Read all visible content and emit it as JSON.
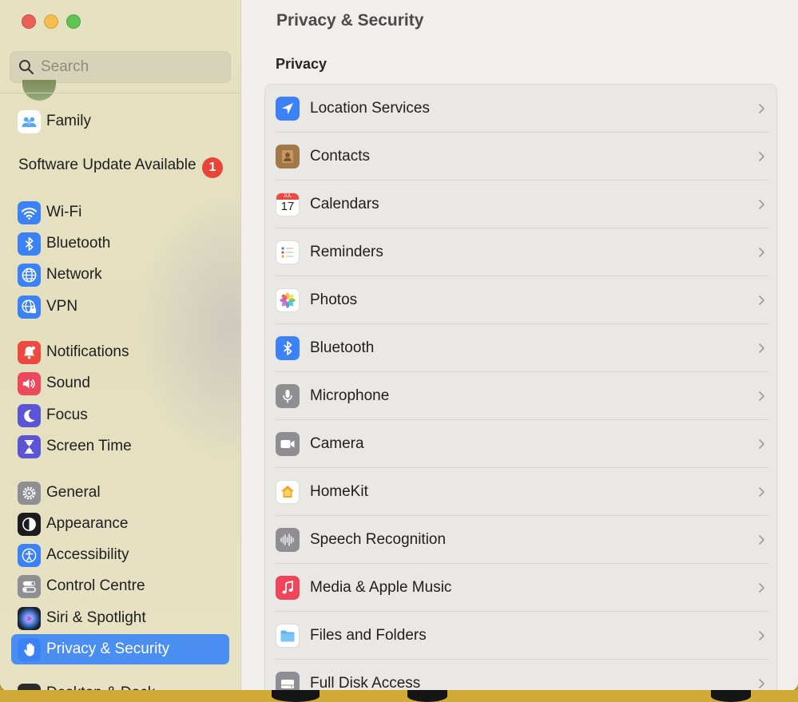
{
  "window": {
    "page_title": "Privacy & Security",
    "section_title": "Privacy"
  },
  "search": {
    "placeholder": "Search"
  },
  "sidebar": {
    "family_label": "Family",
    "software_update_label": "Software Update Available",
    "software_update_badge": "1",
    "items": [
      {
        "label": "Wi-Fi",
        "icon": "wifi-icon",
        "color": "#3b82f6"
      },
      {
        "label": "Bluetooth",
        "icon": "bluetooth-icon",
        "color": "#3b82f6"
      },
      {
        "label": "Network",
        "icon": "globe-icon",
        "color": "#3b82f6"
      },
      {
        "label": "VPN",
        "icon": "vpn-globe-icon",
        "color": "#3b82f6"
      },
      {
        "label": "Notifications",
        "icon": "bell-icon",
        "color": "#ec4a40"
      },
      {
        "label": "Sound",
        "icon": "speaker-icon",
        "color": "#ec4a5c"
      },
      {
        "label": "Focus",
        "icon": "moon-icon",
        "color": "#5b55d6"
      },
      {
        "label": "Screen Time",
        "icon": "hourglass-icon",
        "color": "#5b55d6"
      },
      {
        "label": "General",
        "icon": "gear-icon",
        "color": "#8e8e93"
      },
      {
        "label": "Appearance",
        "icon": "appearance-icon",
        "color": "#1c1c1e"
      },
      {
        "label": "Accessibility",
        "icon": "accessibility-icon",
        "color": "#3b82f6"
      },
      {
        "label": "Control Centre",
        "icon": "control-centre-icon",
        "color": "#8e8e93"
      },
      {
        "label": "Siri & Spotlight",
        "icon": "siri-icon",
        "color": "#2b2b3a"
      },
      {
        "label": "Privacy & Security",
        "icon": "hand-icon",
        "color": "#3b82f6",
        "selected": true
      }
    ],
    "bottom_partial_label": "Desktop & Dock"
  },
  "privacy_rows": [
    {
      "label": "Location Services",
      "icon": "location-arrow-icon",
      "color": "#3b82f6"
    },
    {
      "label": "Contacts",
      "icon": "contacts-icon",
      "color": "#a2774a"
    },
    {
      "label": "Calendars",
      "icon": "calendar-icon",
      "color": "#ffffff",
      "month": "JUL",
      "day": "17"
    },
    {
      "label": "Reminders",
      "icon": "reminders-icon",
      "color": "#ffffff"
    },
    {
      "label": "Photos",
      "icon": "photos-icon",
      "color": "#ffffff"
    },
    {
      "label": "Bluetooth",
      "icon": "bluetooth-icon",
      "color": "#3b82f6"
    },
    {
      "label": "Microphone",
      "icon": "microphone-icon",
      "color": "#8e8e93"
    },
    {
      "label": "Camera",
      "icon": "camera-icon",
      "color": "#8e8e93"
    },
    {
      "label": "HomeKit",
      "icon": "home-icon",
      "color": "#ffffff"
    },
    {
      "label": "Speech Recognition",
      "icon": "waveform-icon",
      "color": "#8e8e93"
    },
    {
      "label": "Media & Apple Music",
      "icon": "music-note-icon",
      "color": "#f2455a"
    },
    {
      "label": "Files and Folders",
      "icon": "folder-icon",
      "color": "#ffffff"
    },
    {
      "label": "Full Disk Access",
      "icon": "disk-icon",
      "color": "#8e8e93"
    }
  ]
}
